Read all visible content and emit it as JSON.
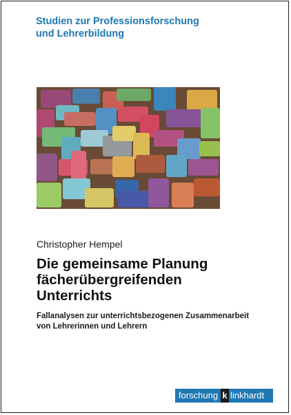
{
  "series": {
    "line1": "Studien zur Professionsforschung",
    "line2": "und Lehrerbildung",
    "color": "#1f78b4"
  },
  "cover_image": {
    "icon": "colorful-wooden-puzzle-blocks-image"
  },
  "author": "Christopher Hempel",
  "title": {
    "line1": "Die gemeinsame Planung",
    "line2": "fächerübergreifenden",
    "line3": "Unterrichts"
  },
  "subtitle": {
    "line1": "Fallanalysen zur unterrichtsbezogenen Zusammenarbeit",
    "line2": "von Lehrerinnen und Lehrern"
  },
  "publisher": {
    "part1": "forschung",
    "part2": "k",
    "part3": "linkhardt",
    "color_blue": "#1f78b4",
    "color_dark": "#1a1a1a"
  }
}
